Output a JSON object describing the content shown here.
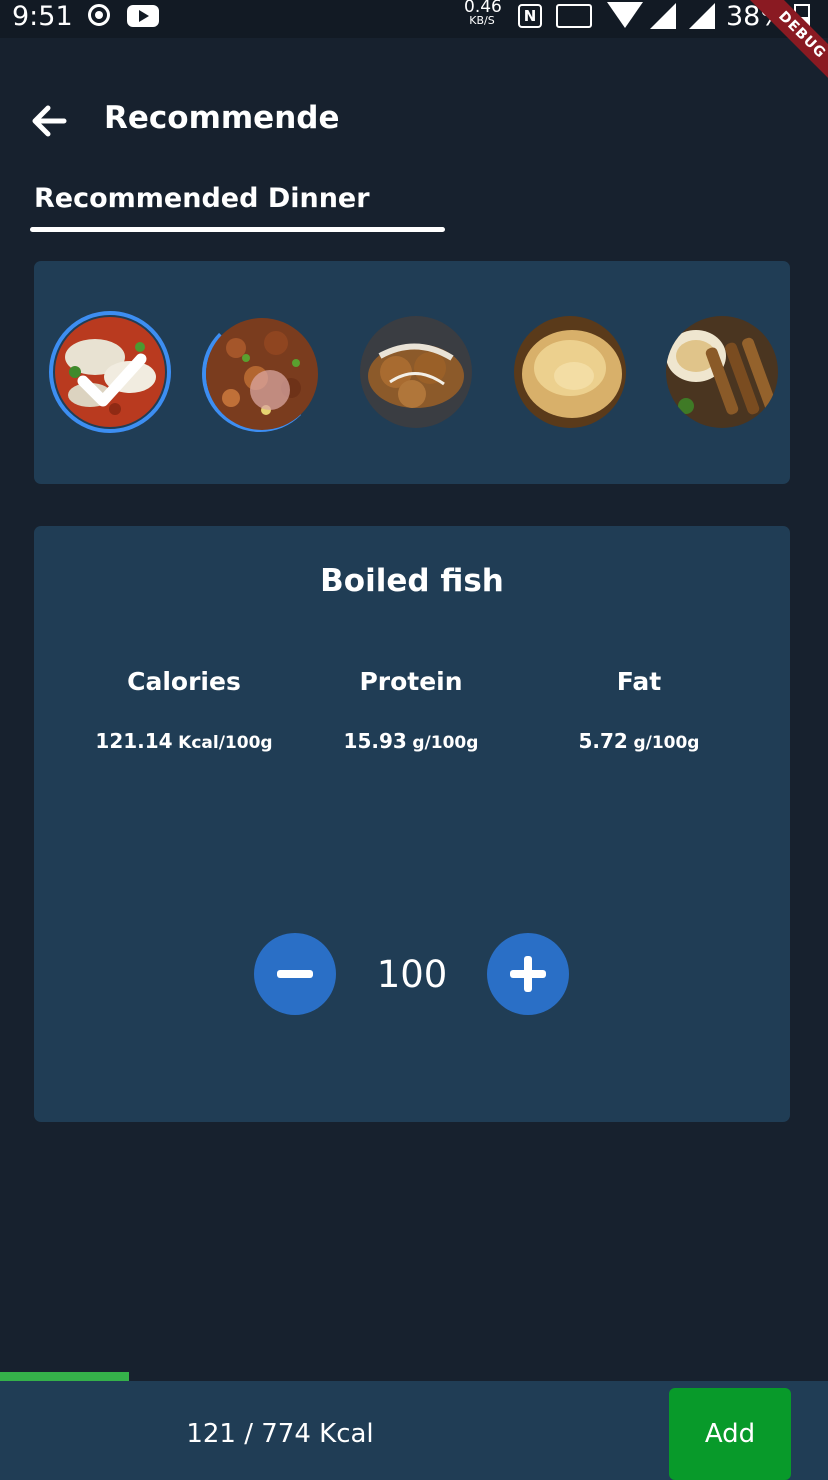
{
  "status_bar": {
    "time": "9:51",
    "net_speed_value": "0.46",
    "net_speed_unit": "KB/S",
    "nfc_label": "N",
    "battery_text": "38%",
    "debug_banner": "DEBUG",
    "icons": [
      "record-icon",
      "youtube-icon",
      "nfc-icon",
      "cast-icon",
      "wifi-icon",
      "signal-icon",
      "signal-icon",
      "battery-icon"
    ]
  },
  "app_bar": {
    "back_icon": "arrow-left-icon",
    "title": "Recommende"
  },
  "tab": {
    "label": "Recommended Dinner"
  },
  "food_picker": {
    "items": [
      {
        "name": "Boiled fish",
        "selected": true,
        "icon": "check-icon"
      },
      {
        "name": "",
        "selected": false
      },
      {
        "name": "",
        "selected": false
      },
      {
        "name": "",
        "selected": false
      },
      {
        "name": "",
        "selected": false
      }
    ]
  },
  "details": {
    "food_name": "Boiled fish",
    "nutrients": [
      {
        "label": "Calories",
        "value": "121.14",
        "unit": "Kcal/100g"
      },
      {
        "label": "Protein",
        "value": "15.93",
        "unit": "g/100g"
      },
      {
        "label": "Fat",
        "value": "5.72",
        "unit": "g/100g"
      }
    ],
    "quantity": "100",
    "minus_icon": "minus-icon",
    "plus_icon": "plus-icon"
  },
  "bottom_bar": {
    "kcal_summary": "121 / 774 Kcal",
    "progress_fraction": 0.156,
    "add_label": "Add"
  },
  "colors": {
    "background": "#17212e",
    "card": "#203d55",
    "accent_blue": "#2a6fc6",
    "progress_green": "#35b14a",
    "add_green": "#089a2a"
  }
}
